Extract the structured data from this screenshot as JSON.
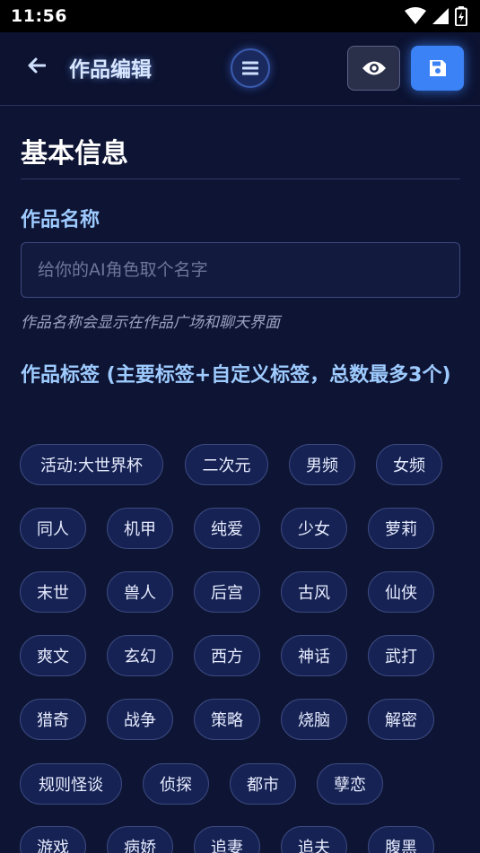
{
  "status_bar": {
    "time": "11:56"
  },
  "header": {
    "title": "作品编辑"
  },
  "basic_info": {
    "section_title": "基本信息",
    "name_label": "作品名称",
    "name_placeholder": "给你的AI角色取个名字",
    "name_value": "",
    "name_hint": "作品名称会显示在作品广场和聊天界面",
    "tags_label": "作品标签 (主要标签+自定义标签，总数最多3个)"
  },
  "tags": [
    "活动:大世界杯",
    "二次元",
    "男频",
    "女频",
    "同人",
    "机甲",
    "纯爱",
    "少女",
    "萝莉",
    "末世",
    "兽人",
    "后宫",
    "古风",
    "仙侠",
    "爽文",
    "玄幻",
    "西方",
    "神话",
    "武打",
    "猎奇",
    "战争",
    "策略",
    "烧脑",
    "解密",
    "规则怪谈",
    "侦探",
    "都市",
    "孽恋",
    "游戏",
    "病娇",
    "追妻",
    "追夫",
    "腹黑"
  ],
  "colors": {
    "background": "#0e1433",
    "accent": "#3b82f6",
    "label": "#9ecbff",
    "tag_bg": "#152253"
  },
  "icons": {
    "back": "arrow-left-icon",
    "menu": "menu-icon",
    "preview": "eye-icon",
    "save": "floppy-disk-icon",
    "wifi": "wifi-icon",
    "signal": "signal-icon",
    "battery": "battery-icon"
  }
}
